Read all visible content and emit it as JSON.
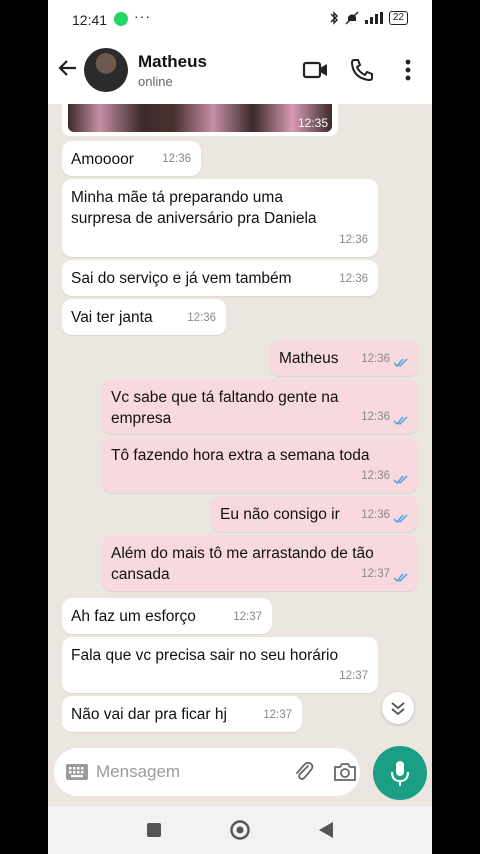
{
  "status_bar": {
    "time": "12:41",
    "battery": "22",
    "more": "···"
  },
  "header": {
    "name": "Matheus",
    "status": "online"
  },
  "photo_message": {
    "time": "12:35"
  },
  "messages": [
    {
      "dir": "in",
      "lines": [
        "Amoooor"
      ],
      "time": "12:36"
    },
    {
      "dir": "in",
      "lines": [
        "Minha mãe tá preparando uma",
        "surpresa de aniversário pra Daniela"
      ],
      "time": "12:36"
    },
    {
      "dir": "in",
      "lines": [
        "Sai do serviço e já vem também"
      ],
      "time": "12:36"
    },
    {
      "dir": "in",
      "lines": [
        "Vai ter janta"
      ],
      "time": "12:36"
    },
    {
      "dir": "out",
      "lines": [
        "Matheus"
      ],
      "time": "12:36",
      "read": true
    },
    {
      "dir": "out",
      "lines": [
        "Vc sabe que tá faltando gente na",
        "empresa"
      ],
      "time": "12:36",
      "read": true
    },
    {
      "dir": "out",
      "lines": [
        "Tô fazendo hora extra a semana toda"
      ],
      "time": "12:36",
      "read": true
    },
    {
      "dir": "out",
      "lines": [
        "Eu não consigo ir"
      ],
      "time": "12:36",
      "read": true
    },
    {
      "dir": "out",
      "lines": [
        "Além do mais tô me arrastando de tão",
        "cansada"
      ],
      "time": "12:37",
      "read": true
    },
    {
      "dir": "in",
      "lines": [
        "Ah faz um esforço"
      ],
      "time": "12:37"
    },
    {
      "dir": "in",
      "lines": [
        "Fala que vc precisa sair no seu horário"
      ],
      "time": "12:37"
    },
    {
      "dir": "in",
      "lines": [
        "Não vai dar pra ficar hj"
      ],
      "time": "12:37"
    }
  ],
  "input": {
    "placeholder": "Mensagem"
  },
  "colors": {
    "accent": "#1a9e84",
    "outgoing_bubble": "#f7d9df",
    "incoming_bubble": "#ffffff",
    "chat_bg": "#ebe6e0",
    "read_ticks": "#4fa3e0"
  },
  "icons": [
    "back-arrow-icon",
    "video-call-icon",
    "phone-icon",
    "more-vert-icon",
    "keyboard-icon",
    "attach-icon",
    "camera-icon",
    "mic-icon",
    "chevron-down-icon",
    "nav-square-icon",
    "nav-circle-icon",
    "nav-back-icon"
  ]
}
